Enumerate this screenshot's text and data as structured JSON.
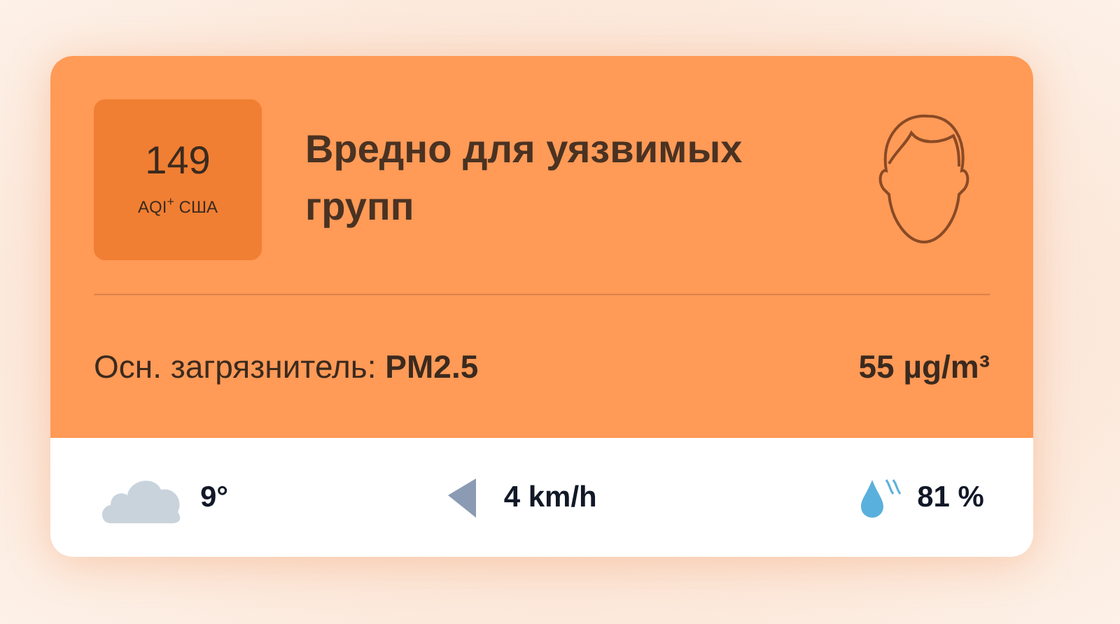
{
  "aqi": {
    "value": "149",
    "label": "AQI$^{+}$ США"
  },
  "status": "Вредно для уязвимых групп",
  "pollutant": {
    "label": "Осн. загрязнитель: **PM2.5**",
    "concentration": "55 µg/m³"
  },
  "weather": {
    "temperature": "9°",
    "wind": "4 km/h",
    "humidity": "81 %"
  }
}
